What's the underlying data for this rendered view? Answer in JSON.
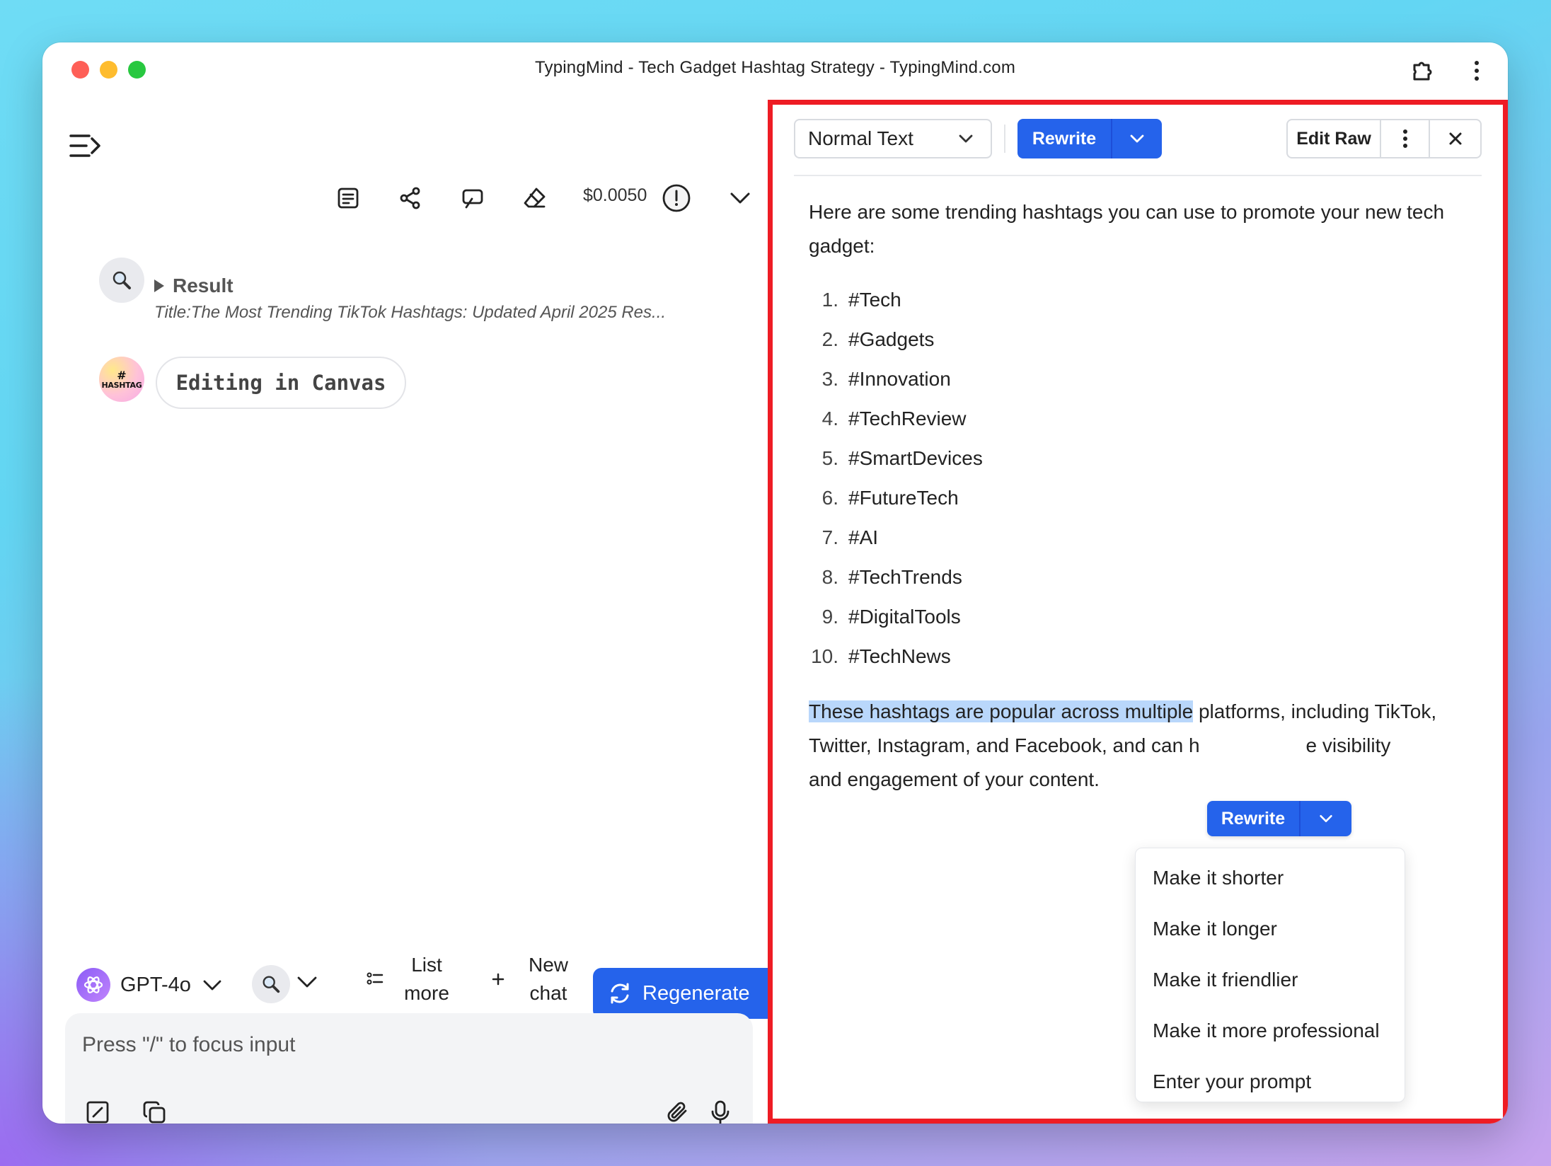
{
  "window": {
    "title": "TypingMind - Tech Gadget Hashtag Strategy - TypingMind.com"
  },
  "chat_header": {
    "cost": "$0.0050"
  },
  "messages": {
    "result": {
      "label": "Result",
      "title": "Title:The Most Trending TikTok Hashtags: Updated April 2025 Res..."
    },
    "assistant": {
      "avatar_line1": "#",
      "avatar_line2": "HASHTAG",
      "status": "Editing in Canvas"
    }
  },
  "chat_toolbar": {
    "model": "GPT-4o",
    "list_more": "List more",
    "new_chat": "New chat",
    "regenerate": "Regenerate"
  },
  "input": {
    "placeholder": "Press \"/\" to focus input"
  },
  "canvas": {
    "text_style": "Normal Text",
    "rewrite": "Rewrite",
    "edit_raw": "Edit Raw",
    "intro": "Here are some trending hashtags you can use to promote your new tech gadget:",
    "hashtags": [
      {
        "num": "1.",
        "tag": "#Tech"
      },
      {
        "num": "2.",
        "tag": "#Gadgets"
      },
      {
        "num": "3.",
        "tag": "#Innovation"
      },
      {
        "num": "4.",
        "tag": "#TechReview"
      },
      {
        "num": "5.",
        "tag": "#SmartDevices"
      },
      {
        "num": "6.",
        "tag": "#FutureTech"
      },
      {
        "num": "7.",
        "tag": "#AI"
      },
      {
        "num": "8.",
        "tag": "#TechTrends"
      },
      {
        "num": "9.",
        "tag": "#DigitalTools"
      },
      {
        "num": "10.",
        "tag": "#TechNews"
      }
    ],
    "closing_selected": "These hashtags are popular across multiple",
    "closing_line1_rest": " platforms, including TikTok,",
    "closing_line2": "Twitter, Instagram, and Facebook, and can h",
    "closing_line2_tail": "e visibility",
    "closing_line3": "and engagement of your content.",
    "floating_rewrite": "Rewrite",
    "rewrite_menu": [
      "Make it shorter",
      "Make it longer",
      "Make it friendlier",
      "Make it more professional",
      "Enter your prompt"
    ]
  }
}
